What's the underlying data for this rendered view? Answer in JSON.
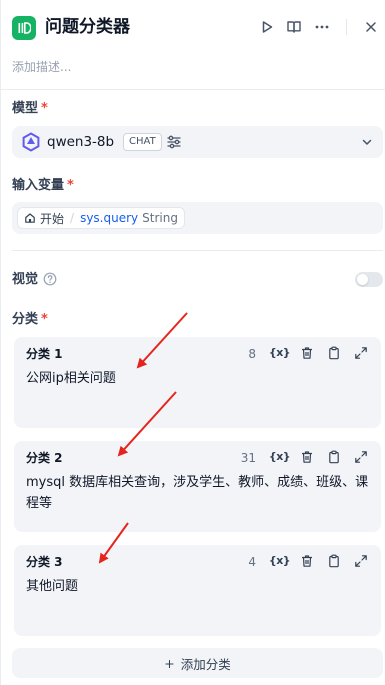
{
  "header": {
    "node_icon": "classifier-icon",
    "title": "问题分类器",
    "run_icon": "play-icon",
    "layout_icon": "book-open-icon",
    "more_icon": "more-horizontal-icon",
    "close_icon": "close-icon"
  },
  "description_placeholder": "添加描述...",
  "model": {
    "label": "模型",
    "required_mark": "*",
    "name": "qwen3-8b",
    "badge": "CHAT"
  },
  "input_vars": {
    "label": "输入变量",
    "required_mark": "*",
    "node": "开始",
    "separator": "/",
    "variable": "sys.query",
    "type": "String"
  },
  "vision": {
    "label": "视觉",
    "enabled": false
  },
  "classes": {
    "label": "分类",
    "required_mark": "*",
    "items": [
      {
        "title": "分类 1",
        "count": "8",
        "text": "公网ip相关问题"
      },
      {
        "title": "分类 2",
        "count": "31",
        "text": "mysql 数据库相关查询，涉及学生、教师、成绩、班级、课程等"
      },
      {
        "title": "分类 3",
        "count": "4",
        "text": "其他问题"
      }
    ],
    "var_tool": "{x}"
  },
  "add_class": {
    "plus": "+",
    "label": "添加分类"
  },
  "colors": {
    "accent_green": "#16b364",
    "variable_blue": "#155eef",
    "required_red": "#f04438",
    "annotation_red": "#e5251d"
  }
}
